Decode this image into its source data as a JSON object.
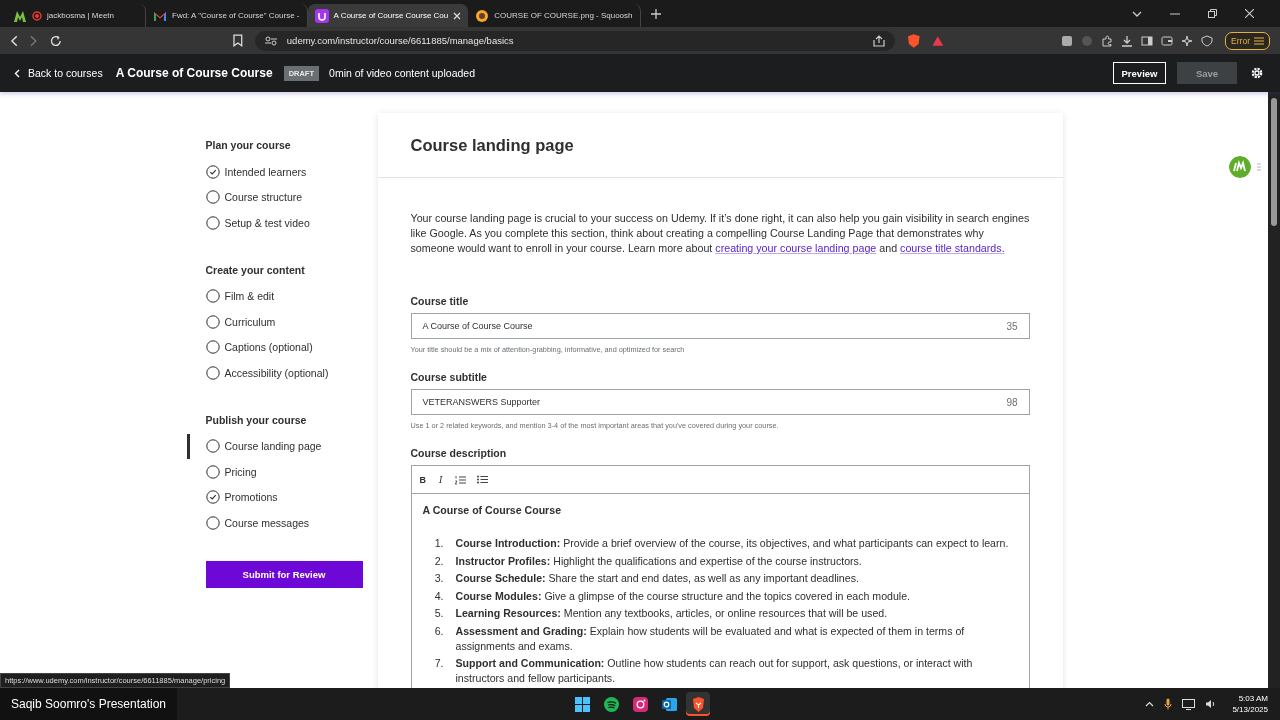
{
  "browser": {
    "tabs": [
      {
        "title": "jackbosma | Meetn",
        "kind": "meetn",
        "recording": true,
        "selected": false
      },
      {
        "title": "Fwd: A \"Course of Course\" Course -",
        "kind": "mail",
        "recording": false,
        "selected": false
      },
      {
        "title": "A Course of Course Course Cou",
        "kind": "udemy",
        "recording": false,
        "selected": true
      },
      {
        "title": "COURSE OF COURSE.png - Squoosh",
        "kind": "squoosh",
        "recording": false,
        "selected": false
      }
    ],
    "url": "udemy.com/instructor/course/6611885/manage/basics",
    "error_button": "Error"
  },
  "header": {
    "back": "Back to courses",
    "title": "A Course of Course Course",
    "badge": "DRAFT",
    "status": "0min of video content uploaded",
    "preview": "Preview",
    "save": {
      "label": "Save",
      "disabled": true
    }
  },
  "sidebar": {
    "sections": [
      {
        "title": "Plan your course",
        "items": [
          {
            "label": "Intended learners",
            "checked": true,
            "selected": false
          },
          {
            "label": "Course structure",
            "checked": false,
            "selected": false
          },
          {
            "label": "Setup & test video",
            "checked": false,
            "selected": false
          }
        ]
      },
      {
        "title": "Create your content",
        "items": [
          {
            "label": "Film & edit",
            "checked": false,
            "selected": false
          },
          {
            "label": "Curriculum",
            "checked": false,
            "selected": false
          },
          {
            "label": "Captions (optional)",
            "checked": false,
            "selected": false
          },
          {
            "label": "Accessibility (optional)",
            "checked": false,
            "selected": false
          }
        ]
      },
      {
        "title": "Publish your course",
        "items": [
          {
            "label": "Course landing page",
            "checked": false,
            "selected": true
          },
          {
            "label": "Pricing",
            "checked": false,
            "selected": false
          },
          {
            "label": "Promotions",
            "checked": true,
            "selected": false
          },
          {
            "label": "Course messages",
            "checked": false,
            "selected": false
          }
        ]
      }
    ],
    "submit": "Submit for Review"
  },
  "page": {
    "title": "Course landing page",
    "intro": [
      {
        "kind": "text",
        "text": "Your course landing page is crucial to your success on Udemy. If it’s done right, it can also help you gain visibility in search engines like Google. As you complete this section, think about creating a compelling Course Landing Page that demonstrates why someone would want to enroll in your course. Learn more about "
      },
      {
        "kind": "link",
        "text": "creating your course landing page"
      },
      {
        "kind": "text",
        "text": " and "
      },
      {
        "kind": "link",
        "text": "course title standards."
      }
    ],
    "fields": [
      {
        "label": "Course title",
        "value": "A Course of Course Course",
        "count": "35",
        "hint": "Your title should be a mix of attention-grabbing, informative, and optimized for search"
      },
      {
        "label": "Course subtitle",
        "value": "VETERANSWERS Supporter",
        "count": "98",
        "hint": "Use 1 or 2 related keywords, and mention 3-4 of the most important areas that you've covered during your course."
      }
    ],
    "description": {
      "label": "Course description",
      "toolbar": [
        {
          "kind": "bold",
          "text": "B"
        },
        {
          "kind": "italic",
          "text": "I"
        },
        {
          "kind": "numbered"
        },
        {
          "kind": "bulleted"
        }
      ],
      "heading": "A Course of Course Course",
      "items": [
        {
          "number": "1.",
          "text": "**Course Introduction:** Provide a brief overview of the course, its objectives, and what participants can expect to learn."
        },
        {
          "number": "2.",
          "text": "**Instructor Profiles:** Highlight the qualifications and expertise of the course instructors."
        },
        {
          "number": "3.",
          "text": "**Course Schedule:** Share the start and end dates, as well as any important deadlines."
        },
        {
          "number": "4.",
          "text": "**Course Modules:** Give a glimpse of the course structure and the topics covered in each module."
        },
        {
          "number": "5.",
          "text": "**Learning Resources:** Mention any textbooks, articles, or online resources that will be used."
        },
        {
          "number": "6.",
          "text": "**Assessment and Grading:** Explain how students will be evaluated and what is expected of them in terms of assignments and exams."
        },
        {
          "number": "7.",
          "text": "**Support and Communication:** Outline how students can reach out for support, ask questions, or interact with instructors and fellow participants."
        }
      ]
    }
  },
  "status_url": "https://www.udemy.com/instructor/course/6611885/manage/pricing",
  "taskbar": {
    "presentation": "Saqib Soomro's Presentation",
    "apps": [
      {
        "kind": "windows",
        "selected": false
      },
      {
        "kind": "spotify",
        "selected": false
      },
      {
        "kind": "instagram",
        "selected": false
      },
      {
        "kind": "outlook",
        "selected": false
      },
      {
        "kind": "brave",
        "selected": true
      }
    ],
    "time": "5:03 AM",
    "date": "5/13/2025"
  }
}
